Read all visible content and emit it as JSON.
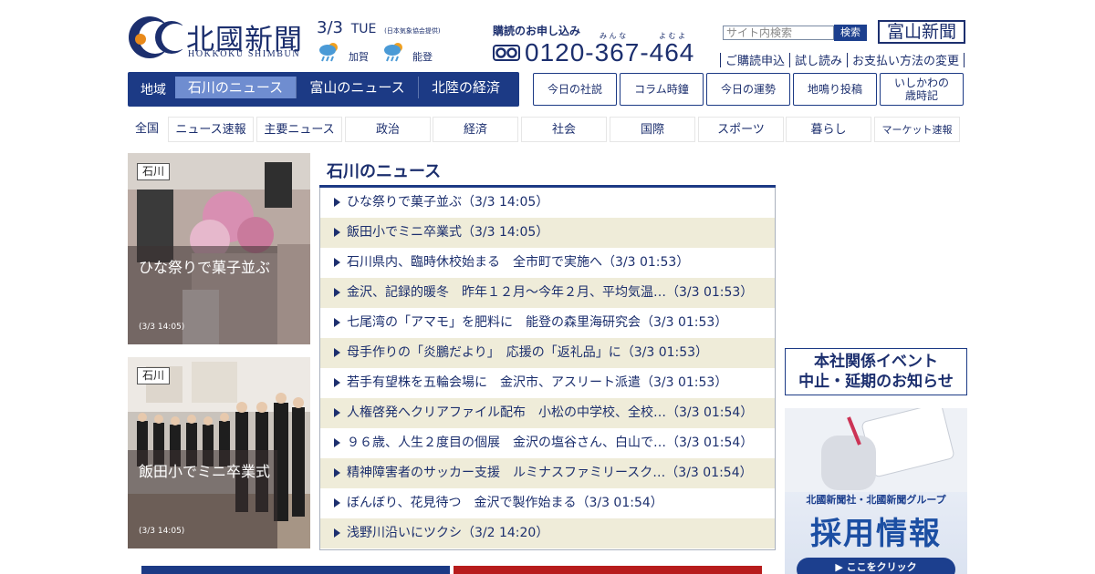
{
  "header": {
    "logo_title": "北國新聞",
    "logo_sub": "HOKKOKU SHIMBUN",
    "date": "3/3",
    "weekday": "TUE",
    "weather_source": "(日本気象協会提供)",
    "weather": [
      {
        "area": "加賀",
        "icon": "rain-sun-icon"
      },
      {
        "area": "能登",
        "icon": "rain-sun-icon"
      }
    ],
    "subscribe_label": "購読のお申し込み",
    "ruby1": "み ん な",
    "ruby2": "よ む よ",
    "phone": "0120-367-464",
    "search_placeholder": "サイト内検索",
    "search_button": "検索",
    "toyama_button": "富山新聞",
    "links": [
      "ご購読申込",
      "試し読み",
      "お支払い方法の変更"
    ]
  },
  "region_nav": {
    "label": "地域",
    "tabs": [
      {
        "label": "石川のニュース",
        "active": true
      },
      {
        "label": "富山のニュース",
        "active": false
      },
      {
        "label": "北陸の経済",
        "active": false
      }
    ]
  },
  "feature_buttons": [
    "今日の社説",
    "コラム時鐘",
    "今日の運勢",
    "地鳴り投稿",
    "いしかわの\n歳時記"
  ],
  "categories": [
    "全国",
    "ニュース速報",
    "主要ニュース",
    "政治",
    "経済",
    "社会",
    "国際",
    "スポーツ",
    "暮らし",
    "マーケット速報"
  ],
  "photos": [
    {
      "tag": "石川",
      "caption": "ひな祭りで菓子並ぶ",
      "date": "(3/3 14:05)"
    },
    {
      "tag": "石川",
      "caption": "飯田小でミニ卒業式",
      "date": "(3/3 14:05)"
    }
  ],
  "news": {
    "title": "石川のニュース",
    "items": [
      "ひな祭りで菓子並ぶ（3/3 14:05）",
      "飯田小でミニ卒業式（3/3 14:05）",
      "石川県内、臨時休校始まる　全市町で実施へ（3/3 01:53）",
      "金沢、記録的暖冬　昨年１２月～今年２月、平均気温…（3/3 01:53）",
      "七尾湾の「アマモ」を肥料に　能登の森里海研究会（3/3 01:53）",
      "母手作りの「炎鵬だより」　応援の「返礼品」に（3/3 01:53）",
      "若手有望株を五輪会場に　金沢市、アスリート派遣（3/3 01:53）",
      "人権啓発へクリアファイル配布　小松の中学校、全校…（3/3 01:54）",
      "９６歳、人生２度目の個展　金沢の塩谷さん、白山で…（3/3 01:54）",
      "精神障害者のサッカー支援　ルミナスファミリースク…（3/3 01:54）",
      "ぼんぼり、花見待つ　金沢で製作始まる（3/3 01:54）",
      "浅野川沿いにツクシ（3/2 14:20）"
    ]
  },
  "side": {
    "event_notice": "本社関係イベント\n中止・延期のお知らせ",
    "recruit_sub": "北國新聞社・北國新聞グループ",
    "recruit_main": "採用情報",
    "recruit_button": "▶ ここをクリック"
  },
  "colors": {
    "navy": "#1c3a85",
    "active_tab": "#6f8dd0",
    "alt_row": "#efecd9"
  }
}
